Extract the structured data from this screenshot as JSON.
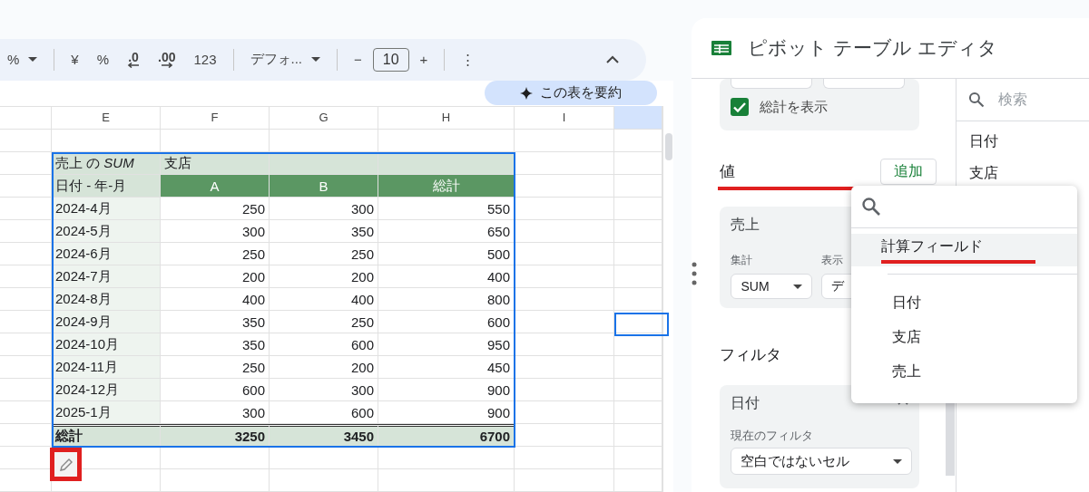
{
  "toolbar": {
    "groups": [
      [
        {
          "kind": "dropdown",
          "label": "%"
        }
      ],
      [
        {
          "kind": "button",
          "label": "¥"
        },
        {
          "kind": "button",
          "label": "%"
        },
        {
          "kind": "decimal-less",
          "label": ".0"
        },
        {
          "kind": "decimal-more",
          "label": ".00"
        },
        {
          "kind": "button",
          "label": "123"
        }
      ],
      [
        {
          "kind": "dropdown",
          "label": "デフォ..."
        }
      ],
      [
        {
          "kind": "button",
          "label": "−"
        },
        {
          "kind": "field",
          "label": "10"
        },
        {
          "kind": "button",
          "label": "+"
        }
      ],
      [
        {
          "kind": "more",
          "label": "⋮"
        }
      ]
    ]
  },
  "summary_button": {
    "label": "この表を要約"
  },
  "sheet": {
    "columns": [
      "E",
      "F",
      "G",
      "H",
      "I"
    ],
    "pivot": {
      "corner": "売上 の *SUM*",
      "column_field": "支店",
      "row_label": "日付 - 年-月",
      "column_headers": [
        "A",
        "B",
        "総計"
      ],
      "rows": [
        {
          "label": "2024-4月",
          "values": [
            "250",
            "300",
            "550"
          ]
        },
        {
          "label": "2024-5月",
          "values": [
            "300",
            "350",
            "650"
          ]
        },
        {
          "label": "2024-6月",
          "values": [
            "250",
            "250",
            "500"
          ]
        },
        {
          "label": "2024-7月",
          "values": [
            "200",
            "200",
            "400"
          ]
        },
        {
          "label": "2024-8月",
          "values": [
            "400",
            "400",
            "800"
          ]
        },
        {
          "label": "2024-9月",
          "values": [
            "350",
            "250",
            "600"
          ]
        },
        {
          "label": "2024-10月",
          "values": [
            "350",
            "600",
            "950"
          ]
        },
        {
          "label": "2024-11月",
          "values": [
            "250",
            "200",
            "450"
          ]
        },
        {
          "label": "2024-12月",
          "values": [
            "600",
            "300",
            "900"
          ]
        },
        {
          "label": "2025-1月",
          "values": [
            "300",
            "600",
            "900"
          ]
        }
      ],
      "total": {
        "label": "総計",
        "values": [
          "3250",
          "3450",
          "6700"
        ]
      }
    }
  },
  "panel": {
    "title": "ピボット テーブル エディタ",
    "show_totals": {
      "label": "総計を表示",
      "checked": true
    },
    "values": {
      "title": "値",
      "add_button": "追加",
      "card": {
        "field": "売上",
        "summarize_label": "集計",
        "summarize_value": "SUM",
        "show_as_label": "表示",
        "show_as_value": "デ"
      }
    },
    "filters": {
      "title": "フィルタ",
      "card": {
        "field": "日付",
        "status_label": "現在のフィルタ",
        "status_value": "空白ではないセル"
      }
    },
    "field_list": {
      "search_placeholder": "検索",
      "fields": [
        "日付",
        "支店"
      ]
    },
    "field_menu": {
      "items": [
        {
          "label": "計算フィールド",
          "selected": true
        },
        {
          "label": "日付",
          "selected": false
        },
        {
          "label": "支店",
          "selected": false
        },
        {
          "label": "売上",
          "selected": false
        }
      ]
    }
  }
}
